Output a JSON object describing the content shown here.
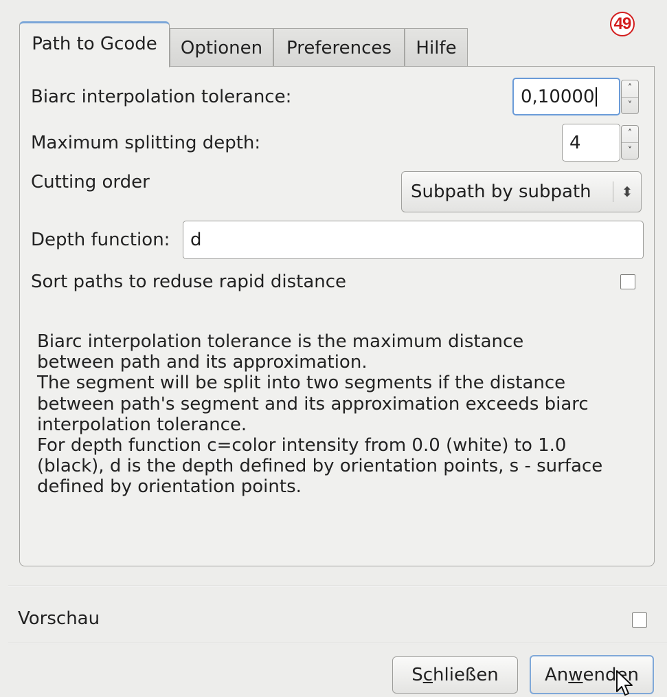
{
  "badge": "49",
  "tabs": [
    {
      "label": "Path to Gcode",
      "active": true
    },
    {
      "label": "Optionen",
      "active": false
    },
    {
      "label": "Preferences",
      "active": false
    },
    {
      "label": "Hilfe",
      "active": false
    }
  ],
  "form": {
    "tolerance_label": "Biarc interpolation tolerance:",
    "tolerance_value": "0,10000",
    "depth_label": "Maximum splitting depth:",
    "depth_value": "4",
    "order_label": "Cutting order",
    "order_value": "Subpath by subpath",
    "depth_fn_label": "Depth function:",
    "depth_fn_value": "d",
    "sort_label": "Sort paths to reduse rapid distance",
    "sort_checked": false
  },
  "help_lines": [
    "Biarc interpolation tolerance is the maximum distance",
    "between path and its approximation.",
    "The segment will be split into two segments if the distance",
    "between path's segment and its approximation exceeds biarc",
    "interpolation tolerance.",
    "For depth function c=color intensity from 0.0 (white) to 1.0",
    "(black), d is the depth defined by orientation points, s - surface",
    "defined by orientation points."
  ],
  "preview": {
    "label": "Vorschau",
    "checked": false
  },
  "buttons": {
    "close_pre": "S",
    "close_mnemonic": "c",
    "close_post": "hließen",
    "apply_pre": "An",
    "apply_mnemonic": "w",
    "apply_post": "enden"
  },
  "icons": {
    "spin_up": "chevron-up-icon",
    "spin_down": "chevron-down-icon",
    "combo": "updown-chevron-icon",
    "cursor": "mouse-pointer-icon"
  }
}
